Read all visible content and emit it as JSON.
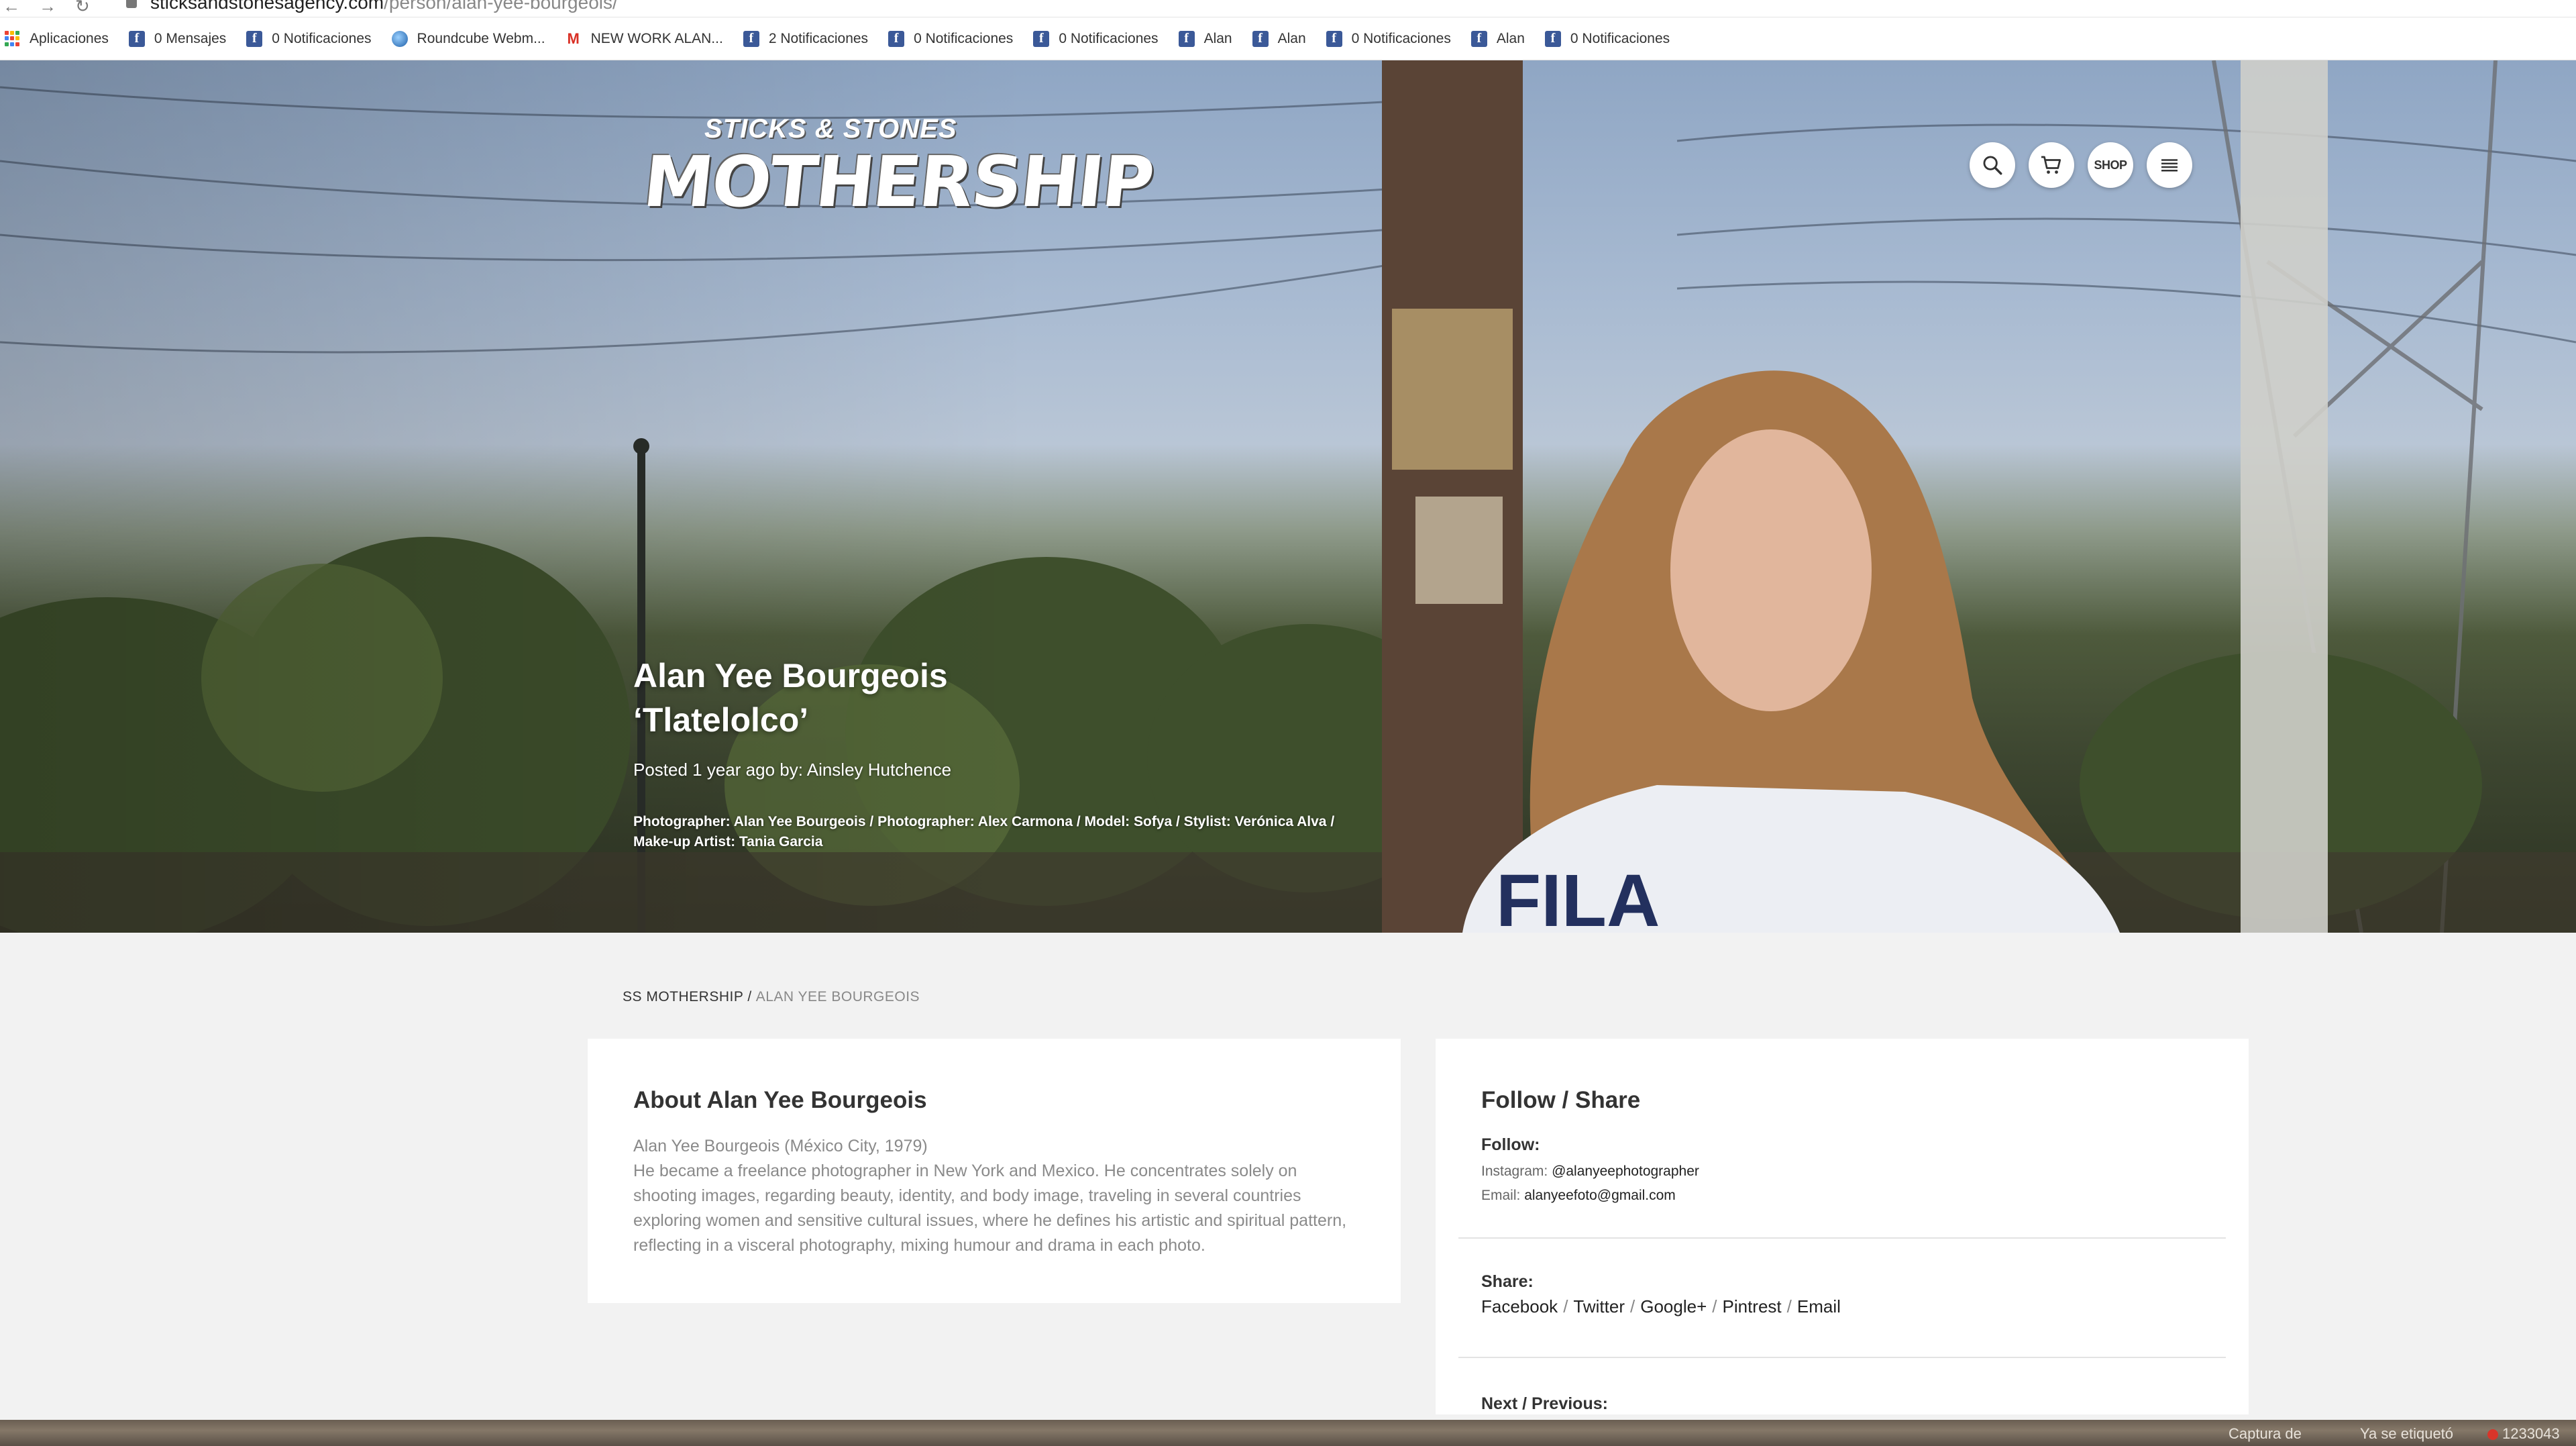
{
  "browser": {
    "url_host": "sticksandstonesagency.com",
    "url_path": "/person/alan-yee-bourgeois/",
    "bookmarks": [
      {
        "label": "Aplicaciones",
        "icon": "apps-grid-icon"
      },
      {
        "label": "0 Mensajes",
        "icon": "facebook-icon"
      },
      {
        "label": "0 Notificaciones",
        "icon": "facebook-icon"
      },
      {
        "label": "Roundcube Webm...",
        "icon": "roundcube-icon"
      },
      {
        "label": "NEW WORK ALAN...",
        "icon": "gmail-icon"
      },
      {
        "label": "2 Notificaciones",
        "icon": "facebook-icon"
      },
      {
        "label": "0 Notificaciones",
        "icon": "facebook-icon"
      },
      {
        "label": "0 Notificaciones",
        "icon": "facebook-icon"
      },
      {
        "label": "Alan",
        "icon": "facebook-icon"
      },
      {
        "label": "Alan",
        "icon": "facebook-icon"
      },
      {
        "label": "0 Notificaciones",
        "icon": "facebook-icon"
      },
      {
        "label": "Alan",
        "icon": "facebook-icon"
      },
      {
        "label": "0 Notificaciones",
        "icon": "facebook-icon"
      }
    ]
  },
  "header": {
    "logo_top": "STICKS & STONES",
    "logo_main": "MOTHERSHIP",
    "shop_label": "SHOP"
  },
  "hero": {
    "title_line1": "Alan Yee Bourgeois",
    "title_line2": "‘Tlatelolco’",
    "posted": "Posted 1 year ago by: Ainsley Hutchence",
    "credits": "Photographer: Alan Yee Bourgeois / Photographer: Alex Carmona / Model: Sofya / Stylist: Verónica Alva / Make-up Artist: Tania Garcia"
  },
  "breadcrumb": {
    "home": "SS MOTHERSHIP",
    "separator": "/",
    "current": "ALAN YEE BOURGEOIS"
  },
  "about": {
    "heading": "About Alan Yee Bourgeois",
    "line1": "Alan Yee Bourgeois (México City, 1979)",
    "body": "He became a freelance photographer in New York and Mexico. He concentrates solely on shooting images, regarding beauty, identity, and body image, traveling in several countries exploring women and sensitive cultural issues, where he defines his artistic and spiritual pattern, reflecting in a visceral photography, mixing humour and drama in each photo."
  },
  "follow": {
    "heading": "Follow / Share",
    "follow_label": "Follow:",
    "instagram_label": "Instagram:",
    "instagram_value": "@alanyeephotographer",
    "email_label": "Email:",
    "email_value": "alanyeefoto@gmail.com",
    "share_label": "Share:",
    "share_links": [
      "Facebook",
      "Twitter",
      "Google+",
      "Pintrest",
      "Email"
    ],
    "share_separator": "/",
    "next_prev_label": "Next / Previous:"
  },
  "dock": {
    "captura": "Captura de",
    "etiqueto": "Ya se etiquetó",
    "count": "1233043"
  },
  "colors": {
    "facebook": "#3b5998",
    "page_bg": "#f2f2f2",
    "card_bg": "#ffffff"
  }
}
